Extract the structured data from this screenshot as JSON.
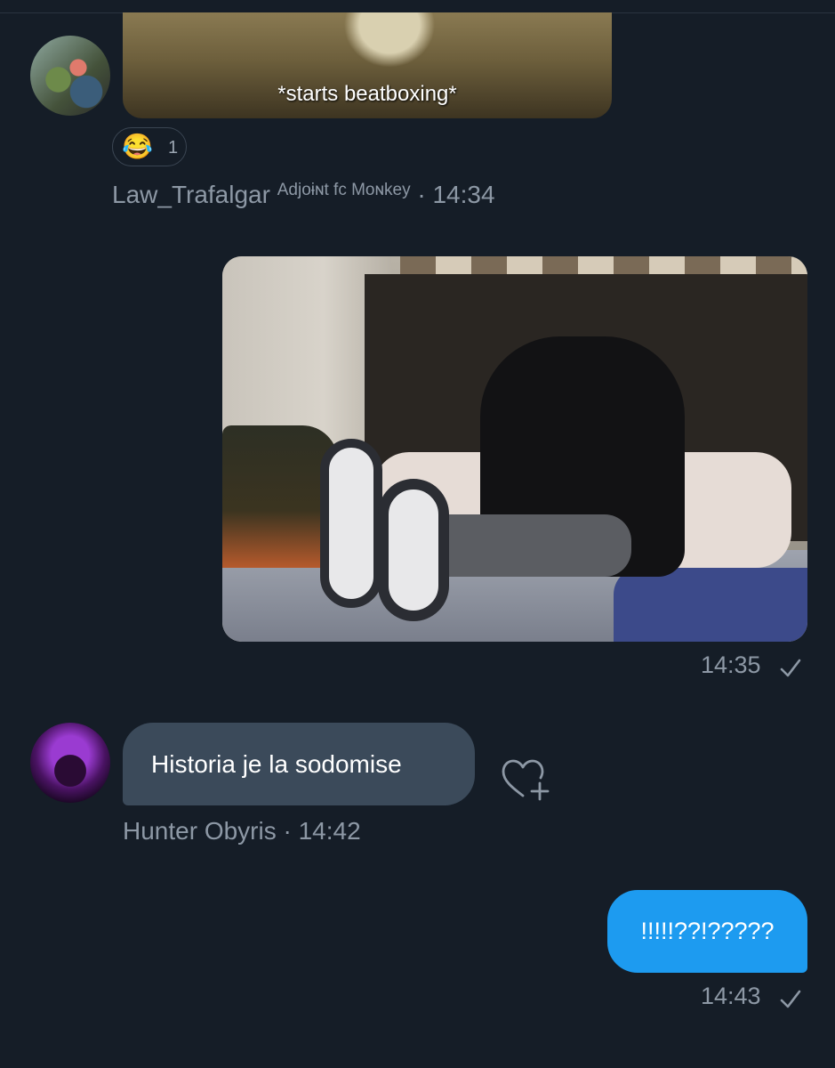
{
  "conversation": {
    "messages": [
      {
        "type": "image",
        "sender": "Law_Trafalgar",
        "caption": "*starts beatboxing*",
        "reaction": {
          "emoji": "😂",
          "count": "1"
        },
        "meta": {
          "name": "Law_Trafalgar",
          "rank": "Adjoɨɴt fc Moɴkey",
          "sep": " · ",
          "time": "14:34"
        }
      },
      {
        "type": "image",
        "sender": "me",
        "time": "14:35",
        "status_icon": "check-icon"
      },
      {
        "type": "text",
        "sender": "Hunter Obyris",
        "text": "Historia je la sodomise",
        "meta": {
          "name": "Hunter Obyris",
          "sep": " · ",
          "time": "14:42"
        },
        "action_icon": "heart-plus-icon"
      },
      {
        "type": "text",
        "sender": "me",
        "text": "!!!!!??!?????",
        "time": "14:43",
        "status_icon": "check-icon"
      }
    ]
  },
  "colors": {
    "background": "#151d27",
    "incoming_bubble": "#3b4a5a",
    "outgoing_bubble": "#1d9bf0",
    "meta_text": "#8d98a5"
  }
}
